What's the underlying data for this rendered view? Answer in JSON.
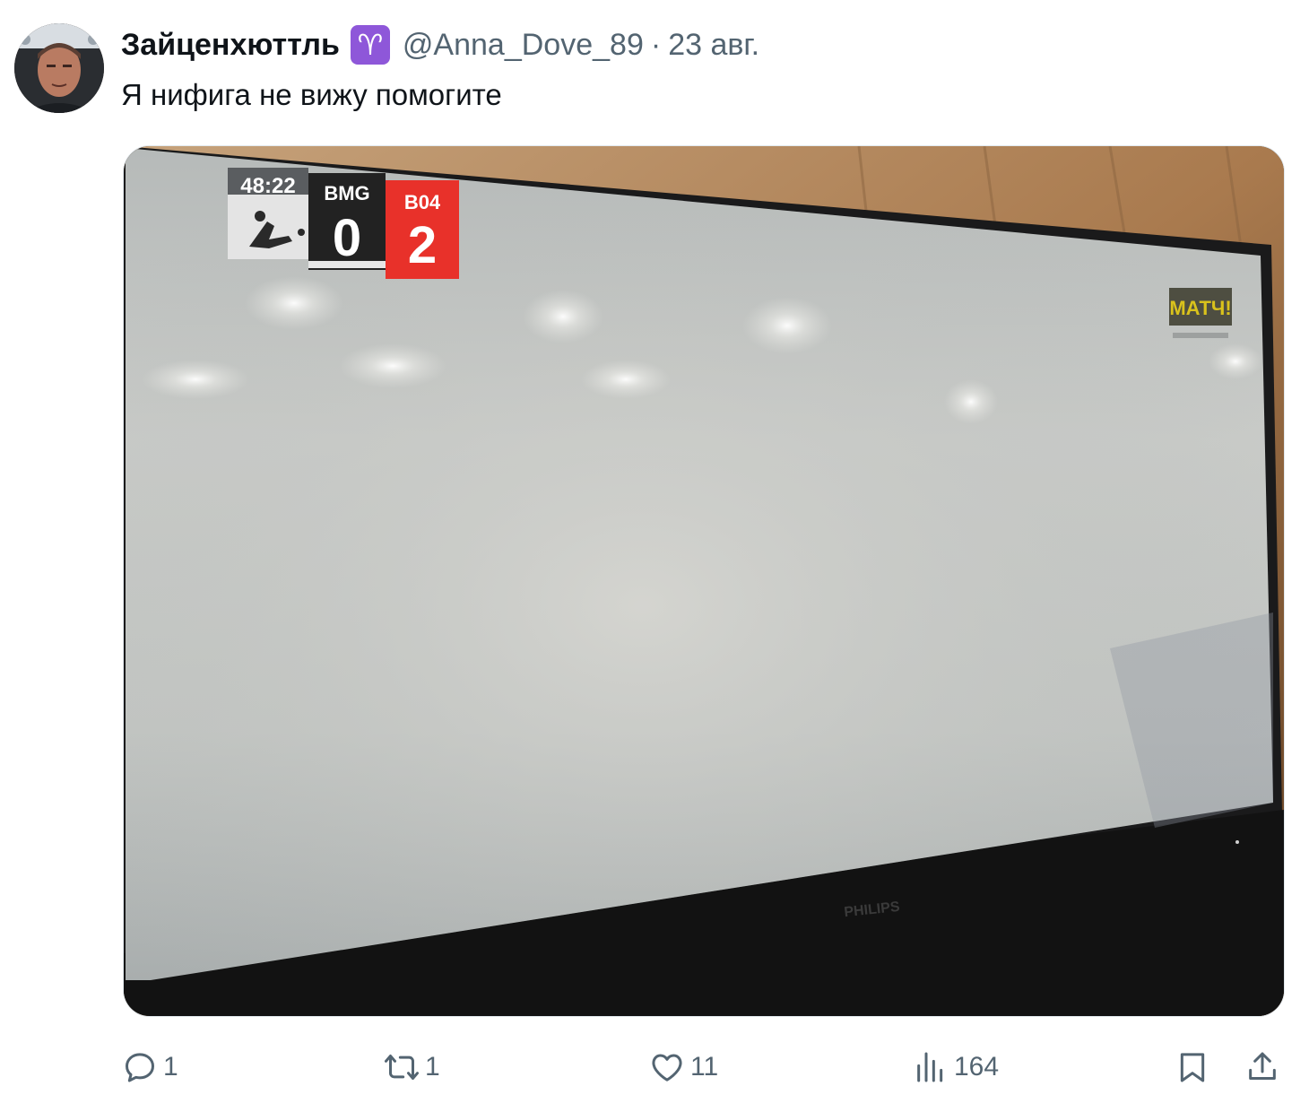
{
  "author": {
    "name": "Зайценхюттль",
    "badge_icon": "aries-icon",
    "badge_glyph": "♈",
    "handle": "@Anna_Dove_89",
    "separator": "·",
    "date": "23 авг."
  },
  "tweet": {
    "text": "Я нифига не вижу помогите"
  },
  "media": {
    "scorebug": {
      "clock": "48:22",
      "home_team": "BMG",
      "home_score": "0",
      "away_team": "B04",
      "away_score": "2"
    },
    "channel_logo": "МАТЧ!",
    "tv_brand": "PHILIPS"
  },
  "actions": {
    "reply_count": "1",
    "retweet_count": "1",
    "like_count": "11",
    "views_count": "164"
  },
  "colors": {
    "text_primary": "#0f1419",
    "text_secondary": "#536471",
    "badge": "#8e57d9",
    "scorebug_red": "#e8312a"
  }
}
